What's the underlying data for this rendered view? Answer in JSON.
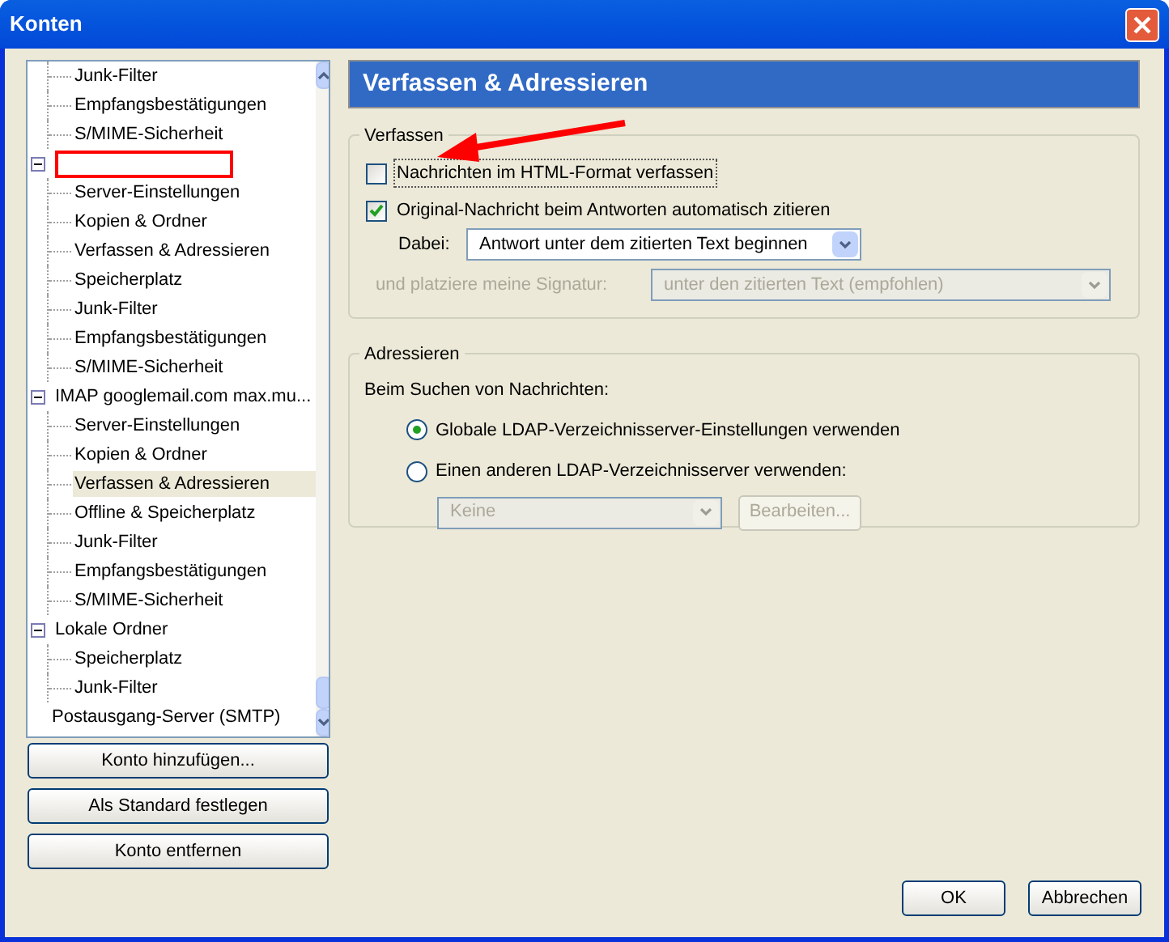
{
  "window": {
    "title": "Konten"
  },
  "tree": [
    {
      "children": [
        {
          "label": "Junk-Filter",
          "selected": false
        },
        {
          "label": "Empfangsbestätigungen",
          "selected": false
        },
        {
          "label": "S/MIME-Sicherheit",
          "selected": false
        }
      ]
    },
    {
      "expanded": true,
      "redacted": true,
      "children": [
        {
          "label": "Server-Einstellungen",
          "selected": false
        },
        {
          "label": "Kopien & Ordner",
          "selected": false
        },
        {
          "label": "Verfassen & Adressieren",
          "selected": false
        },
        {
          "label": "Speicherplatz",
          "selected": false
        },
        {
          "label": "Junk-Filter",
          "selected": false
        },
        {
          "label": "Empfangsbestätigungen",
          "selected": false
        },
        {
          "label": "S/MIME-Sicherheit",
          "selected": false
        }
      ]
    },
    {
      "label": "IMAP googlemail.com max.mu...",
      "expanded": true,
      "children": [
        {
          "label": "Server-Einstellungen",
          "selected": false
        },
        {
          "label": "Kopien & Ordner",
          "selected": false
        },
        {
          "label": "Verfassen & Adressieren",
          "selected": true
        },
        {
          "label": "Offline & Speicherplatz",
          "selected": false
        },
        {
          "label": "Junk-Filter",
          "selected": false
        },
        {
          "label": "Empfangsbestätigungen",
          "selected": false
        },
        {
          "label": "S/MIME-Sicherheit",
          "selected": false
        }
      ]
    },
    {
      "label": "Lokale Ordner",
      "expanded": true,
      "children": [
        {
          "label": "Speicherplatz",
          "selected": false
        },
        {
          "label": "Junk-Filter",
          "selected": false
        }
      ]
    },
    {
      "label": "Postausgang-Server (SMTP)"
    }
  ],
  "account_buttons": [
    "Konto hinzufügen...",
    "Als Standard festlegen",
    "Konto entfernen"
  ],
  "panel": {
    "title": "Verfassen & Adressieren",
    "compose": {
      "legend": "Verfassen",
      "checkboxes": [
        {
          "label": "Nachrichten im HTML-Format verfassen",
          "checked": false,
          "focused": true
        },
        {
          "label": "Original-Nachricht beim Antworten automatisch zitieren",
          "checked": true,
          "focused": false
        }
      ],
      "selects": [
        {
          "label": "Dabei:",
          "value": "Antwort unter dem zitierten Text beginnen",
          "disabled": false
        },
        {
          "label": "und platziere meine Signatur:",
          "value": "unter den zitierten Text (empfohlen)",
          "disabled": true
        }
      ]
    },
    "addressing": {
      "legend": "Adressieren",
      "intro": "Beim Suchen von Nachrichten:",
      "radios": [
        {
          "label": "Globale LDAP-Verzeichnisserver-Einstellungen verwenden",
          "selected": true
        },
        {
          "label": "Einen anderen LDAP-Verzeichnisserver verwenden:",
          "selected": false
        }
      ],
      "server_select": {
        "value": "Keine",
        "disabled": true
      },
      "edit_button": {
        "label": "Bearbeiten...",
        "disabled": true
      }
    }
  },
  "annotation": {
    "kind": "arrow"
  },
  "dialog_buttons": [
    "OK",
    "Abbrechen"
  ]
}
